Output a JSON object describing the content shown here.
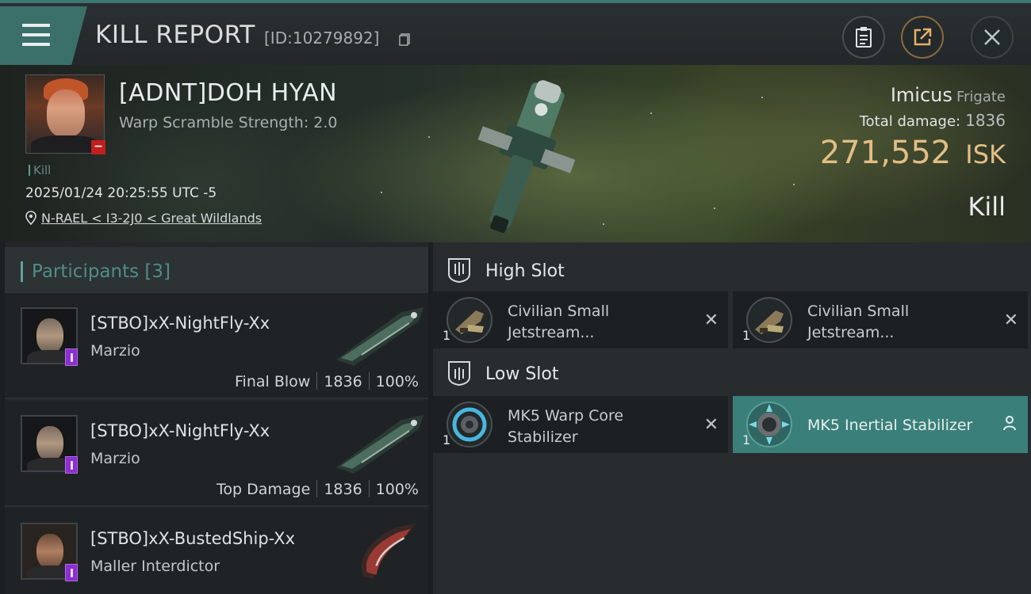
{
  "header": {
    "title": "KILL REPORT",
    "report_id": "[ID:10279892]"
  },
  "victim": {
    "name": "[ADNT]DOH HYAN",
    "warp_scramble": "Warp Scramble Strength: 2.0",
    "tag": "Kill",
    "datetime": "2025/01/24 20:25:55 UTC -5",
    "location": "N-RAEL < I3-2J0 < Great Wildlands",
    "ship_name": "Imicus",
    "ship_class": "Frigate",
    "total_damage_label": "Total damage:",
    "total_damage": "1836",
    "isk_value": "271,552",
    "isk_unit": "ISK",
    "result": "Kill"
  },
  "participants": {
    "title": "Participants [3]",
    "rows": [
      {
        "name": "[STBO]xX-NightFly-Xx",
        "ship": "Marzio",
        "role": "Final Blow",
        "damage": "1836",
        "percent": "100%"
      },
      {
        "name": "[STBO]xX-NightFly-Xx",
        "ship": "Marzio",
        "role": "Top Damage",
        "damage": "1836",
        "percent": "100%"
      },
      {
        "name": "[STBO]xX-BustedShip-Xx",
        "ship": "Maller Interdictor"
      }
    ]
  },
  "slots": {
    "high": {
      "label": "High Slot",
      "modules": [
        {
          "name": "Civilian Small Jetstream...",
          "qty": "1"
        },
        {
          "name": "Civilian Small Jetstream...",
          "qty": "1"
        }
      ]
    },
    "low": {
      "label": "Low Slot",
      "modules": [
        {
          "name": "MK5 Warp Core Stabilizer",
          "qty": "1"
        },
        {
          "name": "MK5 Inertial Stabilizer",
          "qty": "1"
        }
      ]
    }
  },
  "colors": {
    "accent_teal": "#3b6f6a",
    "isk_gold": "#e2be83",
    "selected_module": "#3a7f79",
    "badge_purple": "#8a2fd0"
  }
}
